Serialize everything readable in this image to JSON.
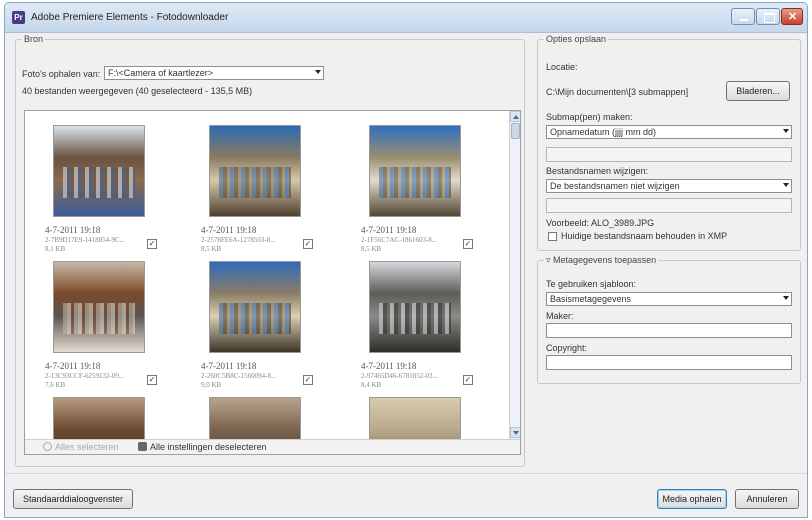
{
  "window": {
    "title": "Adobe Premiere Elements - Fotodownloader",
    "app_icon_letter": "Pr"
  },
  "source": {
    "legend": "Bron",
    "fetch_label": "Foto's ophalen van:",
    "fetch_value": "F:\\<Camera of kaartlezer>",
    "summary": "40 bestanden weergegeven (40 geselecteerd - 135,5 MB)",
    "thumbnails": [
      {
        "date": "4-7-2011 19:18",
        "file": "2-7B9D17E9-1418854-9C...",
        "size": "8,1 KB",
        "checked": true,
        "palette": [
          "#6a5340",
          "#d9e3ee",
          "#8a6a4a",
          "#3a5c9a"
        ]
      },
      {
        "date": "4-7-2011 19:18",
        "file": "2-2578FE6A-1278503-8...",
        "size": "8,5 KB",
        "checked": true,
        "palette": [
          "#8a7a60",
          "#2d6ab3",
          "#d8c8a8",
          "#4f4030"
        ]
      },
      {
        "date": "4-7-2011 19:18",
        "file": "2-1F56C7AC-1861603-8...",
        "size": "8,5 KB",
        "checked": true,
        "palette": [
          "#9a8e70",
          "#2f70c0",
          "#e4dcc8",
          "#514735"
        ]
      },
      {
        "date": "4-7-2011 19:18",
        "file": "2-13C93CCF-6259132-09...",
        "size": "7,6 KB",
        "checked": true,
        "palette": [
          "#7a4a2a",
          "#c7b8a5",
          "#5a5450",
          "#e6ddd2"
        ]
      },
      {
        "date": "4-7-2011 19:18",
        "file": "2-260C5B8C-1560094-8...",
        "size": "9,0 KB",
        "checked": true,
        "palette": [
          "#8a7c66",
          "#2f6bb8",
          "#dccfb2",
          "#3c3428"
        ]
      },
      {
        "date": "4-7-2011 19:18",
        "file": "2-97465D46-6781852-03...",
        "size": "8,4 KB",
        "checked": true,
        "palette": [
          "#5c5c58",
          "#d5d8dd",
          "#8a8a86",
          "#2d2d2a"
        ]
      },
      {
        "date": "",
        "file": "",
        "size": "",
        "checked": false,
        "palette": [
          "#6b4a30",
          "#b59b80",
          "#4a3a2c",
          "#d1bea6"
        ]
      },
      {
        "date": "",
        "file": "",
        "size": "",
        "checked": false,
        "palette": [
          "#7a6450",
          "#b8a48e",
          "#5a4a3c",
          "#d4c4b0"
        ]
      },
      {
        "date": "",
        "file": "",
        "size": "",
        "checked": false,
        "palette": [
          "#b9a98a",
          "#d8cbb0",
          "#8f7f66",
          "#e6dcc8"
        ]
      }
    ],
    "select_all": "Alles selecteren",
    "deselect_all": "Alle instellingen deselecteren"
  },
  "save_options": {
    "legend": "Opties opslaan",
    "location_label": "Locatie:",
    "location_value": "C:\\Mijn documenten\\[3 submappen]",
    "browse": "Bladeren...",
    "subfolder_label": "Submap(pen) maken:",
    "subfolder_value": "Opnamedatum (jjjj mm dd)",
    "rename_label": "Bestandsnamen wijzigen:",
    "rename_value": "De bestandsnamen niet wijzigen",
    "example": "Voorbeeld: ALO_3989.JPG",
    "keep_name": "Huidige bestandsnaam behouden in XMP"
  },
  "metadata": {
    "legend": "Metagegevens toepassen",
    "template_label": "Te gebruiken sjabloon:",
    "template_value": "Basismetagegevens",
    "maker_label": "Maker:",
    "copyright_label": "Copyright:"
  },
  "footer": {
    "standard_dialog": "Standaarddialoogvenster",
    "get_media": "Media ophalen",
    "cancel": "Annuleren"
  }
}
